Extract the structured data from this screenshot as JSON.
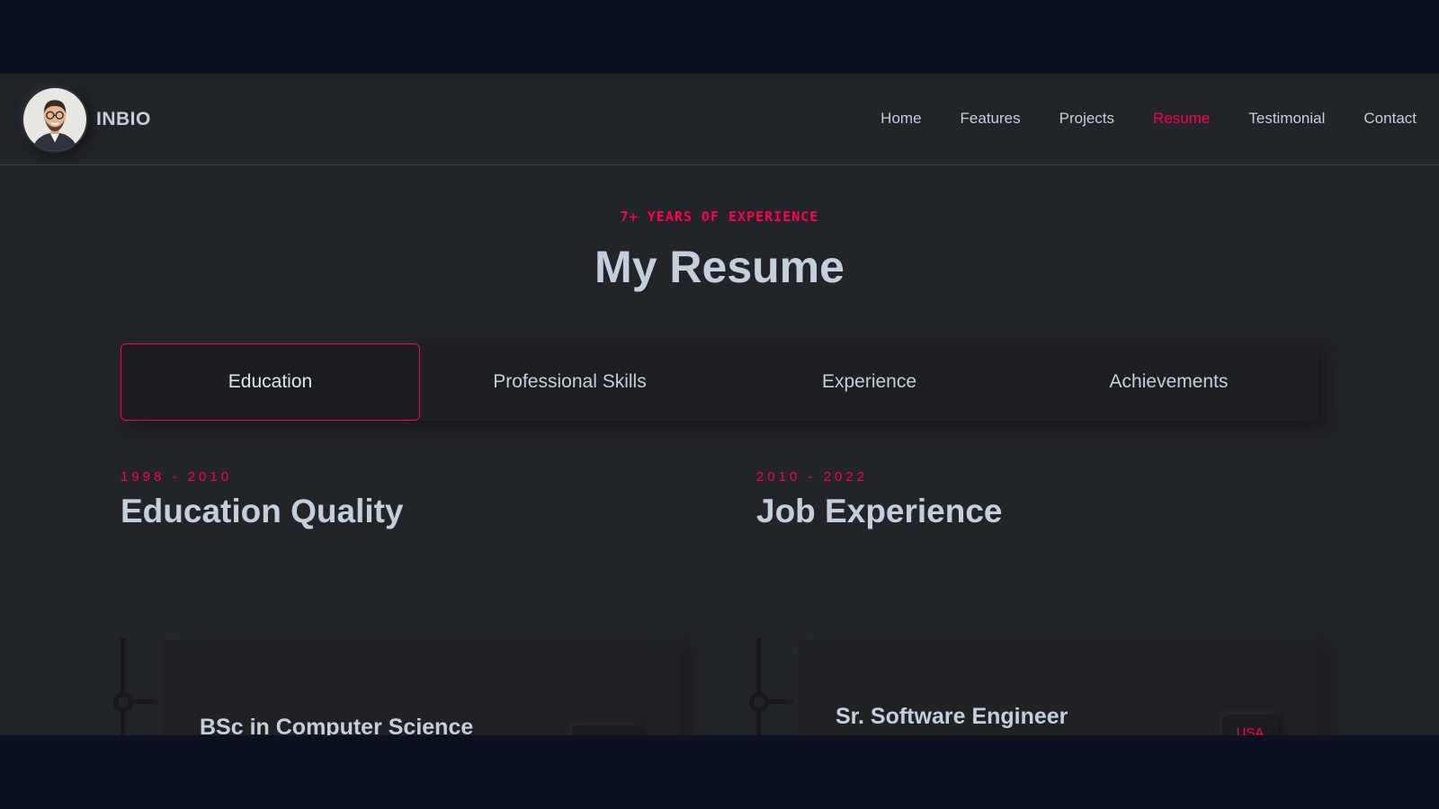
{
  "header": {
    "brand": "INBIO",
    "nav": [
      "Home",
      "Features",
      "Projects",
      "Resume",
      "Testimonial",
      "Contact"
    ],
    "active_nav": "Resume"
  },
  "section": {
    "subtitle": "7+ YEARS OF EXPERIENCE",
    "title": "My Resume"
  },
  "tabs": [
    "Education",
    "Professional Skills",
    "Experience",
    "Achievements"
  ],
  "active_tab": "Education",
  "columns": [
    {
      "years": "1998 - 2010",
      "heading": "Education Quality",
      "card": {
        "title": "BSc in Computer Science",
        "badge": ""
      }
    },
    {
      "years": "2010 - 2022",
      "heading": "Job Experience",
      "card": {
        "title": "Sr. Software Engineer",
        "badge": "USA"
      }
    }
  ],
  "colors": {
    "accent": "#ff014f",
    "background": "#212428",
    "outer_background": "#0b1120",
    "text": "#c4cfde"
  }
}
